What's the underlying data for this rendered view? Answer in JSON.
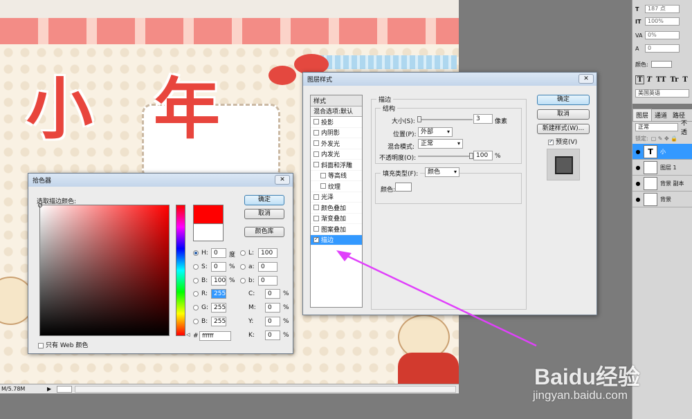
{
  "canvas": {
    "big_chars": [
      "小",
      "年"
    ],
    "status": "M/5.78M"
  },
  "right_panel": {
    "font_size": "187 点",
    "leading": "100%",
    "tracking": "0%",
    "kerning": "0",
    "color_label": "颜色:",
    "style_buttons": [
      "T",
      "T",
      "TT",
      "Tr",
      "T"
    ],
    "language": "美国英语",
    "tabs": [
      "图层",
      "通道",
      "路径"
    ],
    "blend_mode": "正常",
    "opacity_label": "不透",
    "lock_label": "锁定:",
    "layers": [
      {
        "name": "小",
        "thumb": "T",
        "selected": true
      },
      {
        "name": "图层 1",
        "thumb": "",
        "selected": false
      },
      {
        "name": "背景 副本",
        "thumb": "",
        "selected": false
      },
      {
        "name": "背景",
        "thumb": "",
        "selected": false
      }
    ]
  },
  "color_picker": {
    "title": "拾色器",
    "close": "✕",
    "prompt": "选取描边颜色:",
    "ok": "确定",
    "cancel": "取消",
    "library": "颜色库",
    "new_color": "#ff0000",
    "current_color": "#ffffff",
    "hsb": [
      {
        "label": "H:",
        "value": "0",
        "unit": "度"
      },
      {
        "label": "S:",
        "value": "0",
        "unit": "%"
      },
      {
        "label": "B:",
        "value": "100",
        "unit": "%"
      }
    ],
    "rgb": [
      {
        "label": "R:",
        "value": "255"
      },
      {
        "label": "G:",
        "value": "255"
      },
      {
        "label": "B:",
        "value": "255"
      }
    ],
    "lab": [
      {
        "label": "L:",
        "value": "100"
      },
      {
        "label": "a:",
        "value": "0"
      },
      {
        "label": "b:",
        "value": "0"
      }
    ],
    "cmyk": [
      {
        "label": "C:",
        "value": "0",
        "unit": "%"
      },
      {
        "label": "M:",
        "value": "0",
        "unit": "%"
      },
      {
        "label": "Y:",
        "value": "0",
        "unit": "%"
      },
      {
        "label": "K:",
        "value": "0",
        "unit": "%"
      }
    ],
    "hex_label": "#",
    "hex": "ffffff",
    "web_only": "只有 Web 颜色"
  },
  "layer_style": {
    "title": "图层样式",
    "close": "✕",
    "styles_header": "样式",
    "blend_options": "混合选项:默认",
    "effects": [
      {
        "label": "投影",
        "checked": false,
        "indent": false
      },
      {
        "label": "内阴影",
        "checked": false,
        "indent": false
      },
      {
        "label": "外发光",
        "checked": false,
        "indent": false
      },
      {
        "label": "内发光",
        "checked": false,
        "indent": false
      },
      {
        "label": "斜面和浮雕",
        "checked": false,
        "indent": false
      },
      {
        "label": "等高线",
        "checked": false,
        "indent": true
      },
      {
        "label": "纹理",
        "checked": false,
        "indent": true
      },
      {
        "label": "光泽",
        "checked": false,
        "indent": false
      },
      {
        "label": "颜色叠加",
        "checked": false,
        "indent": false
      },
      {
        "label": "渐变叠加",
        "checked": false,
        "indent": false
      },
      {
        "label": "图案叠加",
        "checked": false,
        "indent": false
      },
      {
        "label": "描边",
        "checked": true,
        "indent": false
      }
    ],
    "stroke_group": "描边",
    "structure_group": "结构",
    "size_label": "大小(S):",
    "size_value": "3",
    "size_unit": "像素",
    "position_label": "位置(P):",
    "position_value": "外部",
    "blend_label": "混合模式:",
    "blend_value": "正常",
    "opacity_label": "不透明度(O):",
    "opacity_value": "100",
    "opacity_unit": "%",
    "fill_type_label": "填充类型(F):",
    "fill_type_value": "颜色",
    "color_label": "颜色:",
    "stroke_color": "#ffffff",
    "ok": "确定",
    "cancel": "取消",
    "new_style": "新建样式(W)...",
    "preview": "预览(V)",
    "preview_color": "#5a5a5a"
  },
  "watermark": {
    "brand": "Baidu经验",
    "url": "jingyan.baidu.com"
  },
  "accent": "#e040fb"
}
